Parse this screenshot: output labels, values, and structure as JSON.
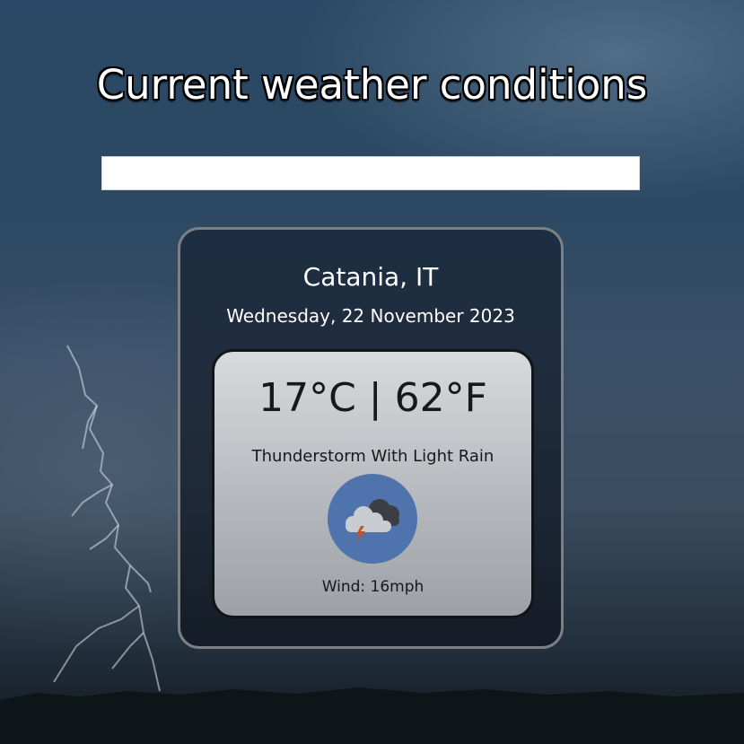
{
  "header": {
    "title": "Current weather conditions"
  },
  "search": {
    "value": "",
    "placeholder": ""
  },
  "weather": {
    "location": "Catania, IT",
    "date": "Wednesday, 22 November 2023",
    "temperature": "17°C | 62°F",
    "condition": "Thunderstorm With Light Rain",
    "icon": "thunderstorm-icon",
    "wind": "Wind: 16mph"
  },
  "colors": {
    "icon_background": "#4e73ad",
    "bolt": "#c0542e"
  }
}
